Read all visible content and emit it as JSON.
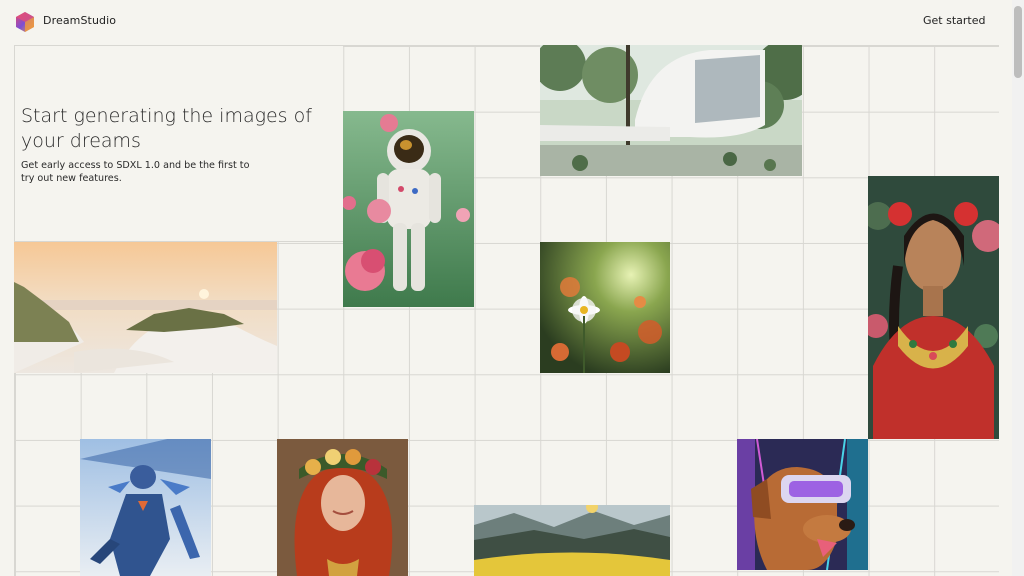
{
  "header": {
    "brand": "DreamStudio",
    "logo_icon": "hexagon-gradient-logo-icon",
    "cta_label": "Get started"
  },
  "hero": {
    "headline": "Start generating the images of your dreams",
    "subtext": "Get early access to SDXL 1.0 and be the first to try out new features."
  },
  "gallery": {
    "images": [
      "astronaut-with-pink-roses",
      "white-modern-house-in-forest",
      "sunset-beach-dunes",
      "daisy-flower-meadow",
      "woman-with-red-flower-crown-portrait",
      "armored-blue-robot-figure",
      "red-haired-woman-flower-crown",
      "mountain-valley-landscape",
      "dog-wearing-vr-headset"
    ]
  },
  "colors": {
    "background": "#f5f4ef",
    "grid_line": "#d8d7d2",
    "text": "#222222"
  }
}
